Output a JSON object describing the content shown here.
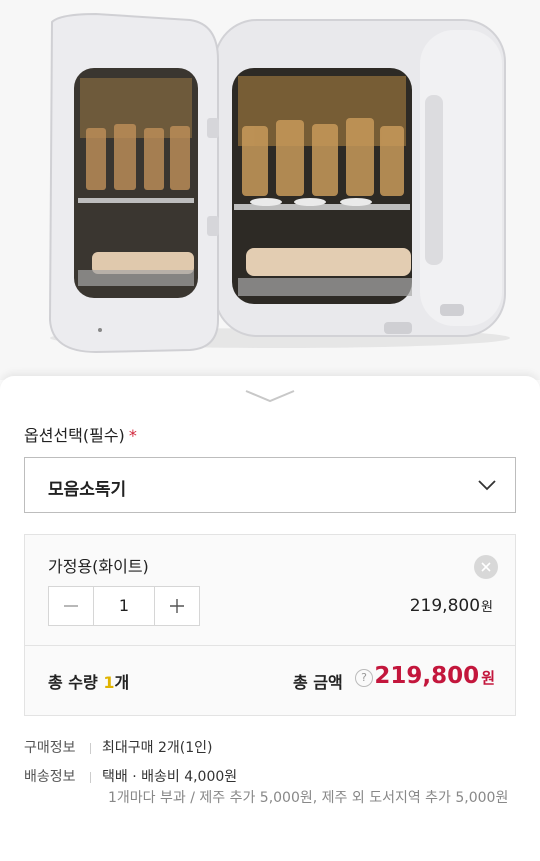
{
  "option_section": {
    "title": "옵션선택(필수)",
    "required_mark": "*",
    "select_value": "모음소독기"
  },
  "selected_option": {
    "name": "가정용(화이트)",
    "quantity": "1",
    "price": "219,800",
    "currency": "원"
  },
  "summary": {
    "qty_prefix": "총 수량 ",
    "qty_number": "1",
    "qty_unit": "개",
    "total_label": "총 금액",
    "help_glyph": "?",
    "total_price": "219,800",
    "currency": "원"
  },
  "purchase_info": {
    "label": "구매정보",
    "value": "최대구매 2개(1인)"
  },
  "delivery_info": {
    "label": "배송정보",
    "value": "택배 · 배송비 4,000원",
    "note": "1개마다 부과 / 제주 추가 5,000원, 제주 외 도서지역 추가 5,000원"
  },
  "colors": {
    "accent_red": "#c3163c",
    "qty_highlight": "#e0b300",
    "required_red": "#d1263b"
  }
}
